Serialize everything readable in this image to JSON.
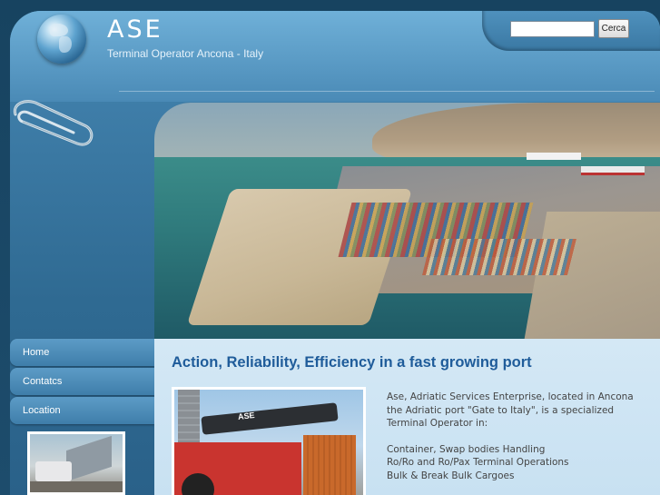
{
  "header": {
    "logo_title": "ASE",
    "logo_subtitle": "Terminal Operator Ancona - Italy"
  },
  "search": {
    "value": "",
    "placeholder": "",
    "button_label": "Cerca"
  },
  "nav": {
    "items": [
      {
        "label": "Home"
      },
      {
        "label": "Contatcs"
      },
      {
        "label": "Location"
      }
    ]
  },
  "main": {
    "title": "Action, Reliability, Efficiency in a fast growing port",
    "intro": "Ase, Adriatic Services Enterprise, located in Ancona the Adriatic port \"Gate to Italy\", is a specialized Terminal Operator in:",
    "services": [
      "Container, Swap bodies Handling",
      "Ro/Ro and Ro/Pax Terminal Operations",
      "Bulk & Break Bulk Cargoes"
    ],
    "photo_caption_text": "ASE"
  },
  "colors": {
    "accent": "#1f5c9a",
    "header_blue": "#4a8ab6",
    "content_bg": "#d4e8f5"
  },
  "icons": {
    "logo": "globe-icon",
    "decoration": "paperclip-icon"
  }
}
